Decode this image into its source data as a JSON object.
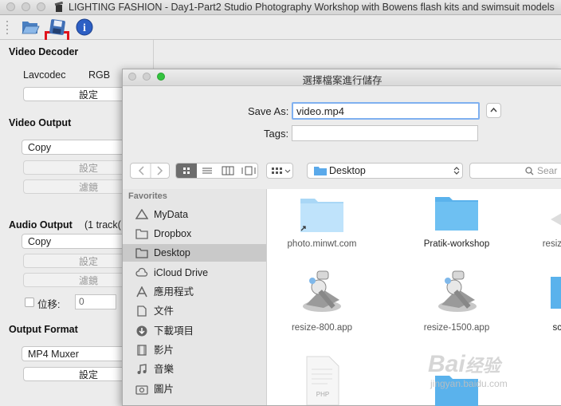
{
  "window": {
    "title": "LIGHTING FASHION - Day1-Part2 Studio Photography Workshop with Bowens flash kits and swimsuit models"
  },
  "toolbar": {
    "icons": [
      "open-folder-icon",
      "save-icon",
      "info-icon"
    ],
    "info_glyph": "i"
  },
  "left_panel": {
    "video_decoder": {
      "title": "Video Decoder",
      "codec": "Lavcodec",
      "colorspace": "RGB",
      "settings_button": "設定"
    },
    "video_output": {
      "title": "Video Output",
      "codec": "Copy",
      "settings_button": "設定",
      "filters_button": "濾鏡"
    },
    "audio_output": {
      "title": "Audio Output",
      "track_info": "(1 track(",
      "codec": "Copy",
      "settings_button": "設定",
      "filters_button": "濾鏡",
      "shift_label": "位移:",
      "shift_value": "0"
    },
    "output_format": {
      "title": "Output Format",
      "format": "MP4 Muxer",
      "settings_button": "設定"
    }
  },
  "dialog": {
    "title": "選擇檔案進行儲存",
    "save_as_label": "Save As:",
    "save_as_value": "video.mp4",
    "tags_label": "Tags:",
    "tags_value": "",
    "location": "Desktop",
    "search_placeholder": "Sear",
    "sidebar": {
      "section": "Favorites",
      "items": [
        {
          "label": "MyData",
          "icon": "drive-icon"
        },
        {
          "label": "Dropbox",
          "icon": "folder-icon"
        },
        {
          "label": "Desktop",
          "icon": "folder-icon",
          "selected": true
        },
        {
          "label": "iCloud Drive",
          "icon": "cloud-icon"
        },
        {
          "label": "應用程式",
          "icon": "applications-icon"
        },
        {
          "label": "文件",
          "icon": "document-icon"
        },
        {
          "label": "下載項目",
          "icon": "download-icon"
        },
        {
          "label": "影片",
          "icon": "movies-icon"
        },
        {
          "label": "音樂",
          "icon": "music-icon"
        },
        {
          "label": "圖片",
          "icon": "pictures-icon"
        }
      ]
    },
    "files": [
      {
        "name": "photo.minwt.com",
        "kind": "folder-alias"
      },
      {
        "name": "Pratik-workshop",
        "kind": "folder"
      },
      {
        "name": "resiz",
        "kind": "app"
      },
      {
        "name": "resize-800.app",
        "kind": "app"
      },
      {
        "name": "resize-1500.app",
        "kind": "app"
      },
      {
        "name": "sc",
        "kind": "folder"
      },
      {
        "name": "",
        "kind": "php-file"
      },
      {
        "name": "",
        "kind": "folder"
      }
    ],
    "php_badge": "PHP"
  },
  "watermark": {
    "brand": "Bai",
    "brand2": "经验",
    "url": "jingyan.baidu.com"
  }
}
